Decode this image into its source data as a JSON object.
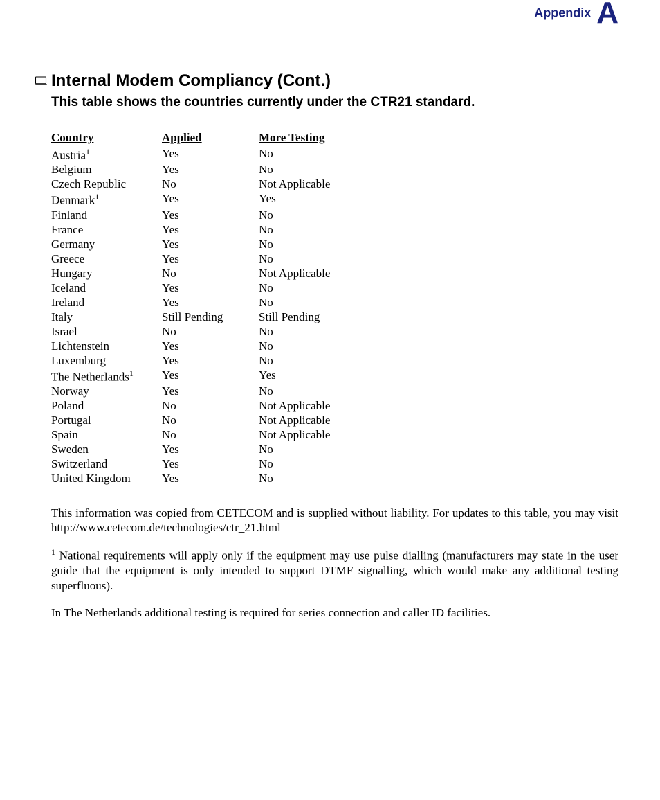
{
  "header": {
    "appendix_word": "Appendix",
    "appendix_letter": "A"
  },
  "title": "Internal Modem Compliancy (Cont.)",
  "subtitle": "This table shows the countries currently under the CTR21 standard.",
  "table": {
    "headers": {
      "country": "Country",
      "applied": "Applied",
      "more": "More Testing"
    },
    "rows": [
      {
        "country": "Austria",
        "sup": "1",
        "applied": "Yes",
        "more": "No"
      },
      {
        "country": "Belgium",
        "sup": "",
        "applied": "Yes",
        "more": "No"
      },
      {
        "country": "Czech Republic",
        "sup": "",
        "applied": "No",
        "more": "Not Applicable"
      },
      {
        "country": "Denmark",
        "sup": "1",
        "applied": "Yes",
        "more": "Yes"
      },
      {
        "country": "Finland",
        "sup": "",
        "applied": "Yes",
        "more": "No"
      },
      {
        "country": "France",
        "sup": "",
        "applied": "Yes",
        "more": "No"
      },
      {
        "country": "Germany",
        "sup": "",
        "applied": "Yes",
        "more": "No"
      },
      {
        "country": "Greece",
        "sup": "",
        "applied": "Yes",
        "more": "No"
      },
      {
        "country": "Hungary",
        "sup": "",
        "applied": "No",
        "more": "Not Applicable"
      },
      {
        "country": "Iceland",
        "sup": "",
        "applied": "Yes",
        "more": "No"
      },
      {
        "country": "Ireland",
        "sup": "",
        "applied": "Yes",
        "more": "No"
      },
      {
        "country": "Italy",
        "sup": "",
        "applied": "Still Pending",
        "more": "Still Pending"
      },
      {
        "country": "Israel",
        "sup": "",
        "applied": "No",
        "more": "No"
      },
      {
        "country": "Lichtenstein",
        "sup": "",
        "applied": "Yes",
        "more": "No"
      },
      {
        "country": "Luxemburg",
        "sup": "",
        "applied": "Yes",
        "more": "No"
      },
      {
        "country": "The Netherlands",
        "sup": "1",
        "applied": "Yes",
        "more": "Yes"
      },
      {
        "country": "Norway",
        "sup": "",
        "applied": "Yes",
        "more": "No"
      },
      {
        "country": "Poland",
        "sup": "",
        "applied": "No",
        "more": "Not Applicable"
      },
      {
        "country": "Portugal",
        "sup": "",
        "applied": "No",
        "more": "Not Applicable"
      },
      {
        "country": "Spain",
        "sup": "",
        "applied": "No",
        "more": "Not Applicable"
      },
      {
        "country": "Sweden",
        "sup": "",
        "applied": "Yes",
        "more": "No"
      },
      {
        "country": "Switzerland",
        "sup": "",
        "applied": "Yes",
        "more": "No"
      },
      {
        "country": "United Kingdom",
        "sup": "",
        "applied": "Yes",
        "more": "No"
      }
    ]
  },
  "paragraphs": {
    "p1": "This information was copied from CETECOM and is supplied without liability. For updates to this table, you may visit http://www.cetecom.de/technologies/ctr_21.html",
    "p2_sup": "1",
    "p2": " National requirements will apply only if the equipment may use pulse dialling (manufacturers may state in the user guide that the equipment is only intended to support DTMF signalling, which would make any additional testing superfluous).",
    "p3": "In The Netherlands additional testing is required for series connection and caller ID facilities."
  }
}
